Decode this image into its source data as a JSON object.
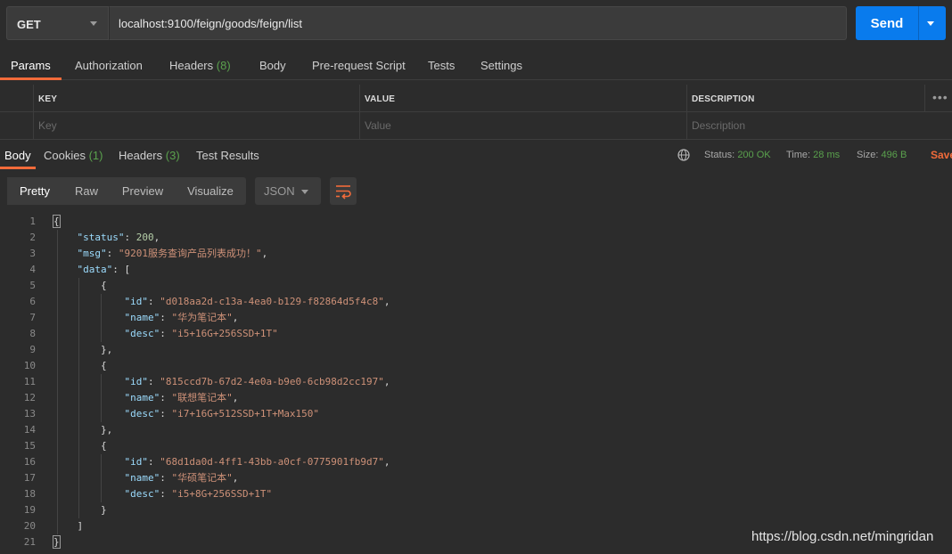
{
  "request": {
    "method": "GET",
    "url": "localhost:9100/feign/goods/feign/list",
    "send_label": "Send"
  },
  "request_tabs": [
    {
      "label": "Params"
    },
    {
      "label": "Authorization"
    },
    {
      "label": "Headers",
      "count": "(8)"
    },
    {
      "label": "Body"
    },
    {
      "label": "Pre-request Script"
    },
    {
      "label": "Tests"
    },
    {
      "label": "Settings"
    }
  ],
  "params_table": {
    "headers": [
      "KEY",
      "VALUE",
      "DESCRIPTION"
    ],
    "placeholders": [
      "Key",
      "Value",
      "Description"
    ],
    "more": "•••"
  },
  "response_tabs": [
    {
      "label": "Body"
    },
    {
      "label": "Cookies",
      "count": "(1)"
    },
    {
      "label": "Headers",
      "count": "(3)"
    },
    {
      "label": "Test Results"
    }
  ],
  "response_stats": {
    "status_label": "Status:",
    "status_value": "200 OK",
    "time_label": "Time:",
    "time_value": "28 ms",
    "size_label": "Size:",
    "size_value": "496 B",
    "save_label": "Save"
  },
  "format_toolbar": {
    "views": [
      "Pretty",
      "Raw",
      "Preview",
      "Visualize"
    ],
    "language": "JSON"
  },
  "code_lines": [
    {
      "no": "1",
      "text": "{"
    },
    {
      "no": "2",
      "text": "    \"status\": 200,"
    },
    {
      "no": "3",
      "text": "    \"msg\": \"9201服务查询产品列表成功！\","
    },
    {
      "no": "4",
      "text": "    \"data\": ["
    },
    {
      "no": "5",
      "text": "        {"
    },
    {
      "no": "6",
      "text": "            \"id\": \"d018aa2d-c13a-4ea0-b129-f82864d5f4c8\","
    },
    {
      "no": "7",
      "text": "            \"name\": \"华为笔记本\","
    },
    {
      "no": "8",
      "text": "            \"desc\": \"i5+16G+256SSD+1T\""
    },
    {
      "no": "9",
      "text": "        },"
    },
    {
      "no": "10",
      "text": "        {"
    },
    {
      "no": "11",
      "text": "            \"id\": \"815ccd7b-67d2-4e0a-b9e0-6cb98d2cc197\","
    },
    {
      "no": "12",
      "text": "            \"name\": \"联想笔记本\","
    },
    {
      "no": "13",
      "text": "            \"desc\": \"i7+16G+512SSD+1T+Max150\""
    },
    {
      "no": "14",
      "text": "        },"
    },
    {
      "no": "15",
      "text": "        {"
    },
    {
      "no": "16",
      "text": "            \"id\": \"68d1da0d-4ff1-43bb-a0cf-0775901fb9d7\","
    },
    {
      "no": "17",
      "text": "            \"name\": \"华硕笔记本\","
    },
    {
      "no": "18",
      "text": "            \"desc\": \"i5+8G+256SSD+1T\""
    },
    {
      "no": "19",
      "text": "        }"
    },
    {
      "no": "20",
      "text": "    ]"
    },
    {
      "no": "21",
      "text": "}"
    }
  ],
  "watermark": "https://blog.csdn.net/mingridan",
  "colors": {
    "accent": "#f26b3a",
    "send": "#097bed",
    "status_ok": "#5aa14d",
    "json_key": "#9cdcfe",
    "json_string": "#ce9178",
    "json_number": "#b5cea8"
  },
  "icons": {
    "globe": "globe-icon",
    "wrap": "wrap-lines-icon",
    "more": "more-horizontal-icon"
  }
}
